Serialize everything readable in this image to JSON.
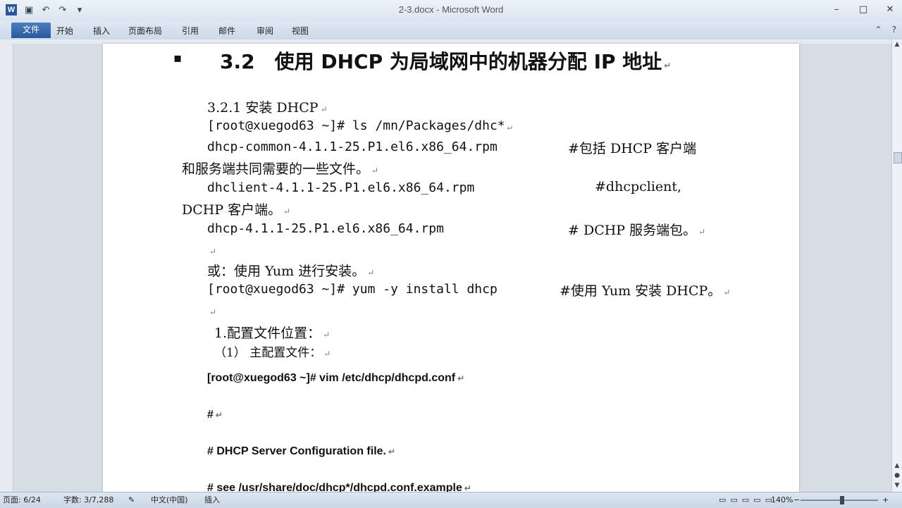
{
  "window": {
    "title": "2-3.docx - Microsoft Word",
    "app_icon": "W",
    "quick_access": [
      "save-icon",
      "undo-icon",
      "redo-icon",
      "customize-icon"
    ],
    "controls": [
      "minimize-icon",
      "maximize-icon",
      "close-icon"
    ]
  },
  "ribbon": {
    "tabs": [
      "文件",
      "开始",
      "插入",
      "页面布局",
      "引用",
      "邮件",
      "审阅",
      "视图"
    ],
    "right_icons": [
      "ribbon-minimize-icon",
      "help-icon"
    ]
  },
  "document": {
    "heading_number": "3.2",
    "heading_text": "使用 DHCP 为局域网中的机器分配 IP 地址",
    "lines": [
      "3.2.1  安装 DHCP",
      "[root@xuegod63 ~]# ls /mn/Packages/dhc*",
      "dhcp-common-4.1.1-25.P1.el6.x86_64.rpm",
      "#包括 DHCP 客户端",
      "和服务端共同需要的一些文件。",
      "dhclient-4.1.1-25.P1.el6.x86_64.rpm",
      "#dhcpclient,",
      "DCHP 客户端。",
      "dhcp-4.1.1-25.P1.el6.x86_64.rpm",
      "# DCHP 服务端包。",
      "或：使用 Yum 进行安装。",
      "[root@xuegod63 ~]# yum -y install dhcp",
      "#使用 Yum 安装 DHCP。",
      "1.配置文件位置：",
      "（1） 主配置文件：",
      "[root@xuegod63 ~]# vim /etc/dhcp/dhcpd.conf",
      "#",
      "# DHCP Server Configuration file.",
      "#    see /usr/share/doc/dhcp*/dhcpd.conf.example"
    ],
    "paragraph_mark": "↵"
  },
  "status": {
    "page": "页面: 6/24",
    "words": "字数: 3/7,288",
    "language": "中文(中国)",
    "mode": "插入",
    "zoom": "140%",
    "zoom_minus": "−",
    "zoom_plus": "+"
  }
}
